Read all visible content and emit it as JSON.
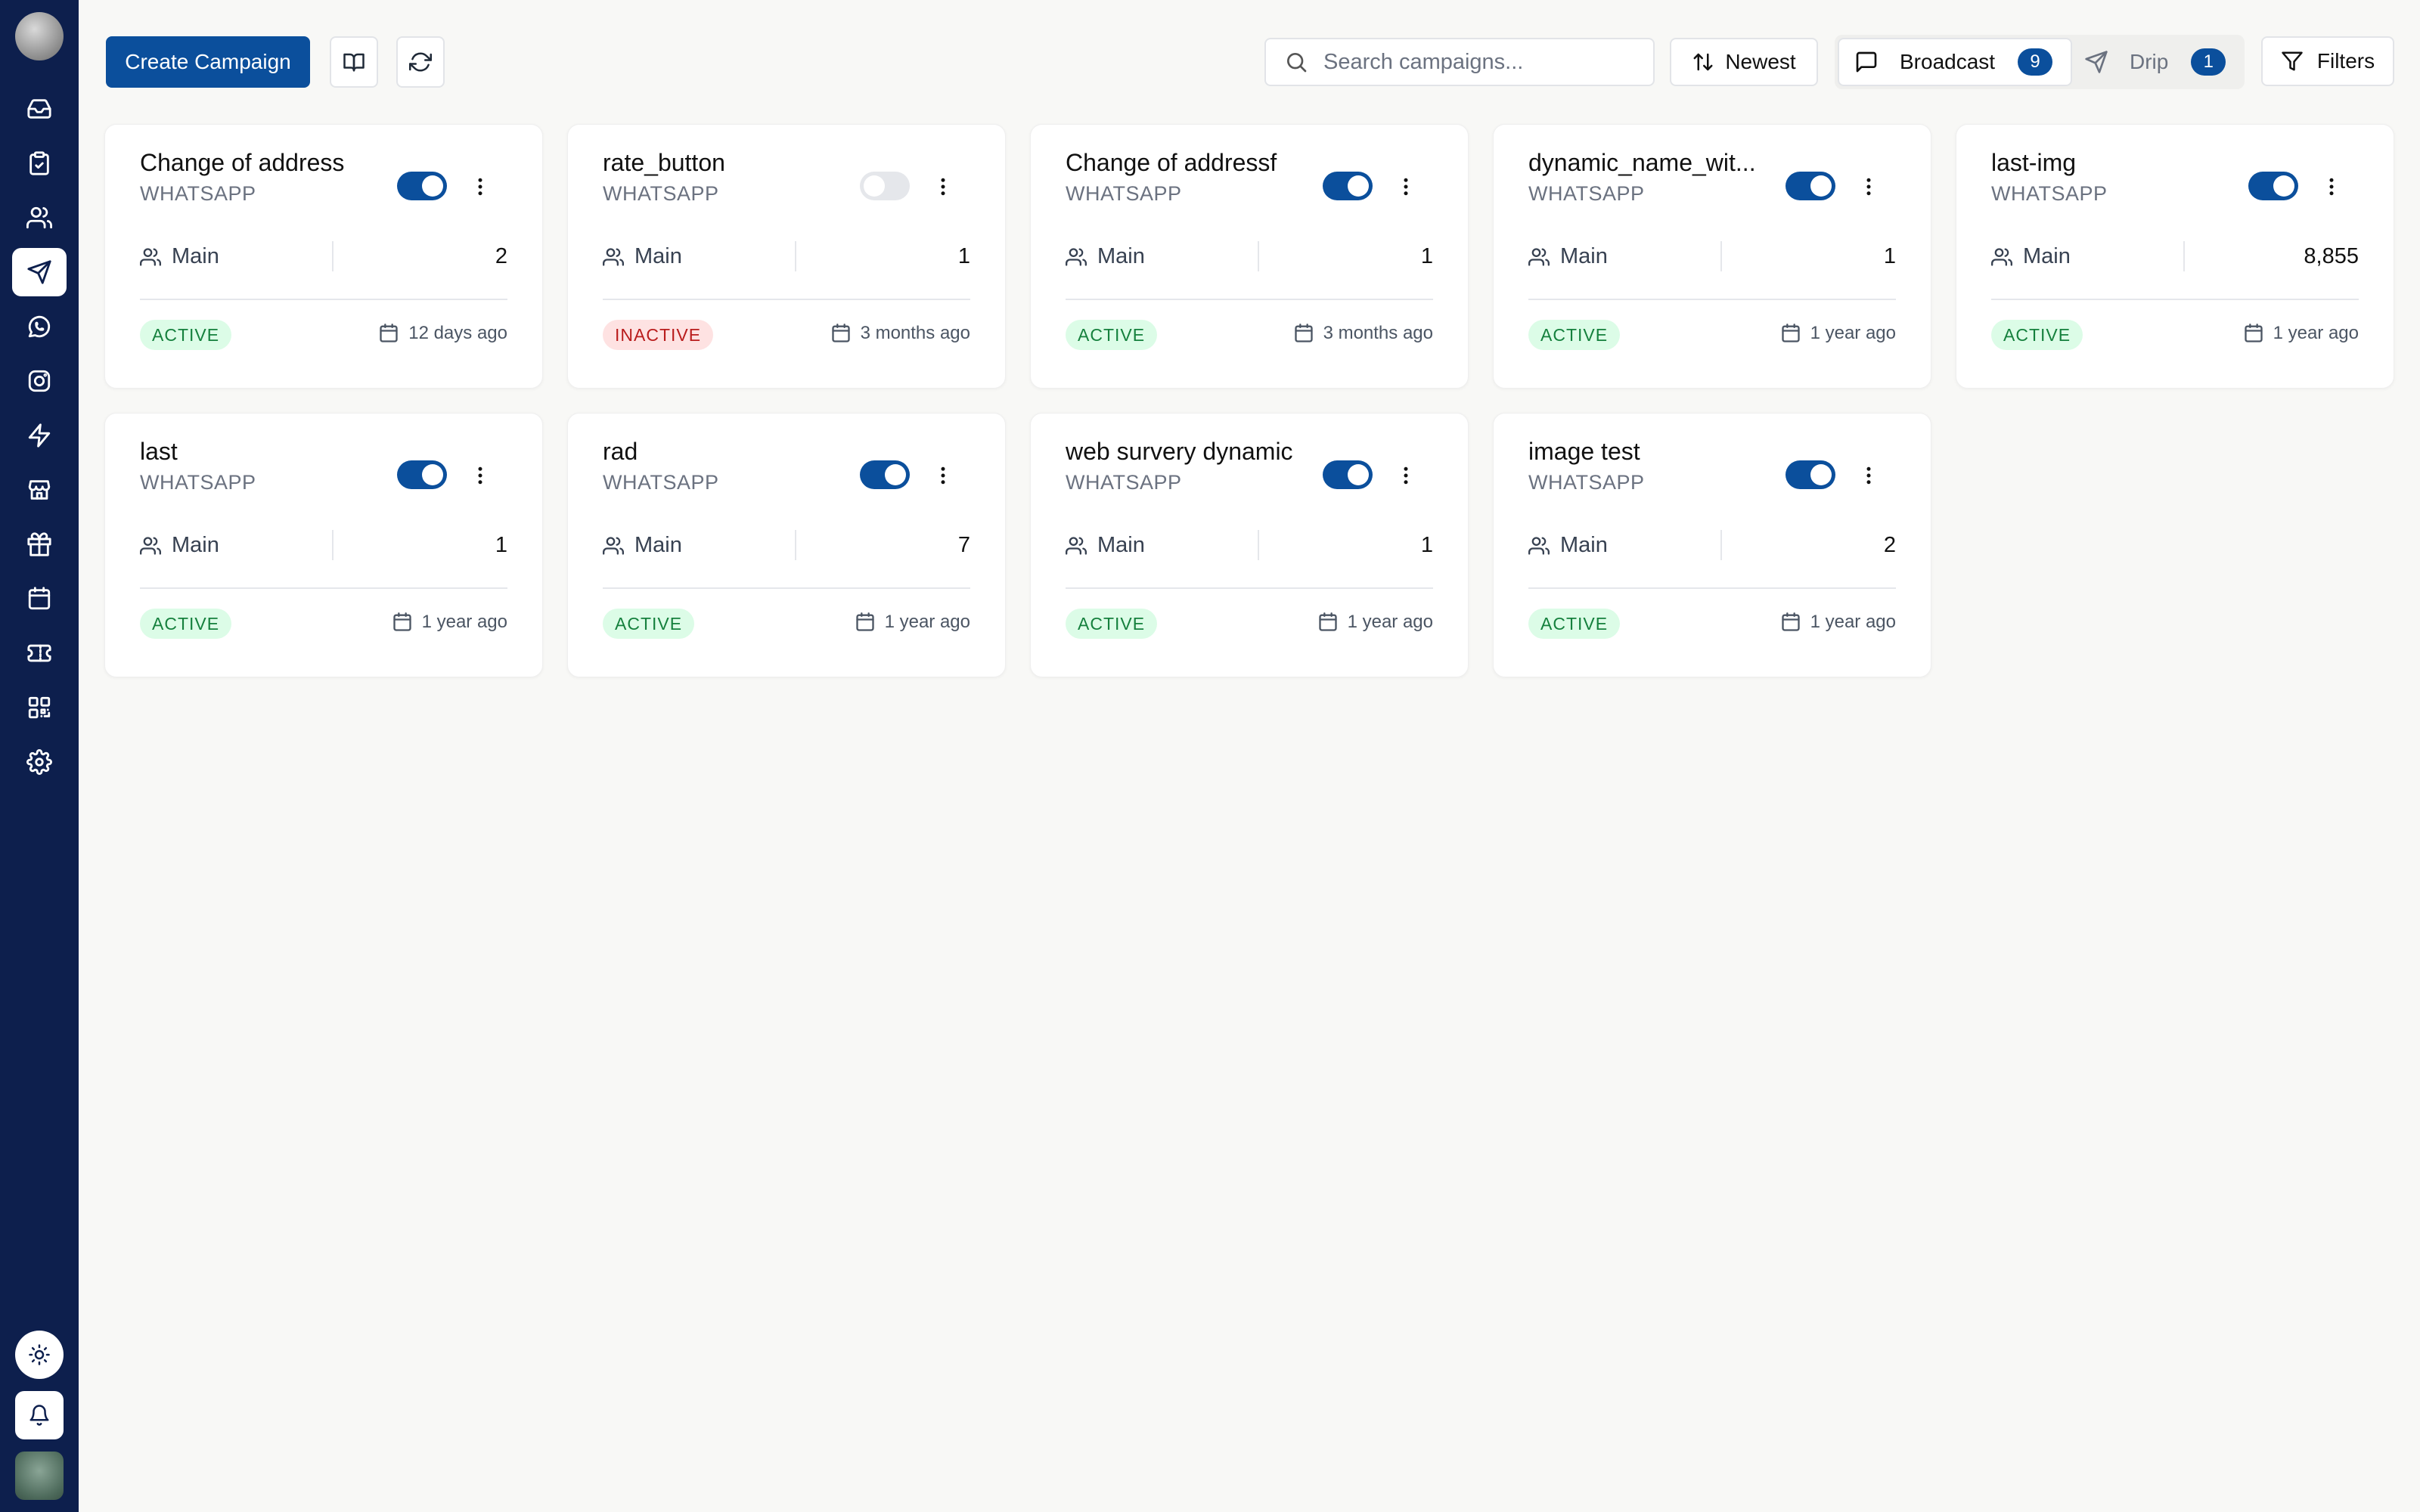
{
  "toolbar": {
    "create_label": "Create Campaign",
    "search_placeholder": "Search campaigns...",
    "sort_label": "Newest",
    "filters_label": "Filters",
    "tabs": [
      {
        "label": "Broadcast",
        "count": "9",
        "icon": "message-square-icon"
      },
      {
        "label": "Drip",
        "count": "1",
        "icon": "send-icon"
      }
    ]
  },
  "sidebar": {
    "items": [
      "inbox-icon",
      "clipboard-icon",
      "users-icon",
      "send-icon",
      "whatsapp-icon",
      "instagram-icon",
      "zap-icon",
      "store-icon",
      "gift-icon",
      "calendar-icon",
      "ticket-icon",
      "qr-code-icon",
      "settings-icon"
    ],
    "active_index": 3
  },
  "colors": {
    "sidebar_bg": "#0d1f4d",
    "primary": "#0b4f9c",
    "active_bg": "#dcfce7",
    "active_text": "#15803d",
    "inactive_bg": "#fee2e2",
    "inactive_text": "#b91c1c"
  },
  "campaigns": [
    {
      "title": "Change of address",
      "channel": "WHATSAPP",
      "audience": "Main",
      "count": "2",
      "status": "ACTIVE",
      "enabled": true,
      "date": "12 days ago"
    },
    {
      "title": "rate_button",
      "channel": "WHATSAPP",
      "audience": "Main",
      "count": "1",
      "status": "INACTIVE",
      "enabled": false,
      "date": "3 months ago"
    },
    {
      "title": "Change of addressf",
      "channel": "WHATSAPP",
      "audience": "Main",
      "count": "1",
      "status": "ACTIVE",
      "enabled": true,
      "date": "3 months ago"
    },
    {
      "title": "dynamic_name_wit...",
      "channel": "WHATSAPP",
      "audience": "Main",
      "count": "1",
      "status": "ACTIVE",
      "enabled": true,
      "date": "1 year ago"
    },
    {
      "title": "last-img",
      "channel": "WHATSAPP",
      "audience": "Main",
      "count": "8,855",
      "status": "ACTIVE",
      "enabled": true,
      "date": "1 year ago"
    },
    {
      "title": "last",
      "channel": "WHATSAPP",
      "audience": "Main",
      "count": "1",
      "status": "ACTIVE",
      "enabled": true,
      "date": "1 year ago"
    },
    {
      "title": "rad",
      "channel": "WHATSAPP",
      "audience": "Main",
      "count": "7",
      "status": "ACTIVE",
      "enabled": true,
      "date": "1 year ago"
    },
    {
      "title": "web survery dynamic",
      "channel": "WHATSAPP",
      "audience": "Main",
      "count": "1",
      "status": "ACTIVE",
      "enabled": true,
      "date": "1 year ago"
    },
    {
      "title": "image test",
      "channel": "WHATSAPP",
      "audience": "Main",
      "count": "2",
      "status": "ACTIVE",
      "enabled": true,
      "date": "1 year ago"
    }
  ]
}
